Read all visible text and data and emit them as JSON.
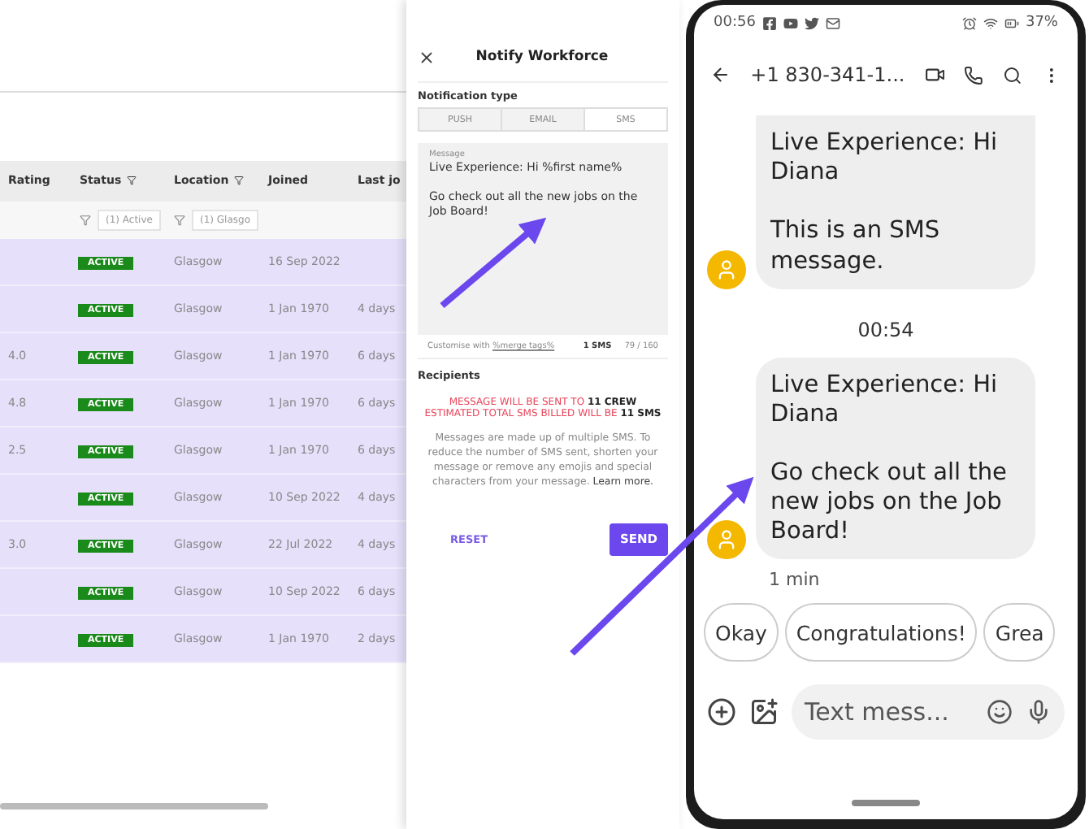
{
  "table": {
    "columns": [
      {
        "label": "Rating"
      },
      {
        "label": "Status",
        "filter": "(1) Active"
      },
      {
        "label": "Location",
        "filter": "(1) Glasgo"
      },
      {
        "label": "Joined"
      },
      {
        "label": "Last jo"
      }
    ],
    "rows": [
      {
        "rating": "",
        "status": "ACTIVE",
        "location": "Glasgow",
        "joined": "16 Sep 2022",
        "last": ""
      },
      {
        "rating": "",
        "status": "ACTIVE",
        "location": "Glasgow",
        "joined": "1 Jan 1970",
        "last": "4 days"
      },
      {
        "rating": "4.0",
        "status": "ACTIVE",
        "location": "Glasgow",
        "joined": "1 Jan 1970",
        "last": "6 days"
      },
      {
        "rating": "4.8",
        "status": "ACTIVE",
        "location": "Glasgow",
        "joined": "1 Jan 1970",
        "last": "6 days"
      },
      {
        "rating": "2.5",
        "status": "ACTIVE",
        "location": "Glasgow",
        "joined": "1 Jan 1970",
        "last": "6 days"
      },
      {
        "rating": "",
        "status": "ACTIVE",
        "location": "Glasgow",
        "joined": "10 Sep 2022",
        "last": "4 days"
      },
      {
        "rating": "3.0",
        "status": "ACTIVE",
        "location": "Glasgow",
        "joined": "22 Jul 2022",
        "last": "4 days"
      },
      {
        "rating": "",
        "status": "ACTIVE",
        "location": "Glasgow",
        "joined": "10 Sep 2022",
        "last": "6 days"
      },
      {
        "rating": "",
        "status": "ACTIVE",
        "location": "Glasgow",
        "joined": "1 Jan 1970",
        "last": "2 days"
      }
    ]
  },
  "panel": {
    "title": "Notify Workforce",
    "type_label": "Notification type",
    "tabs": [
      {
        "label": "PUSH",
        "selected": false
      },
      {
        "label": "EMAIL",
        "selected": false
      },
      {
        "label": "SMS",
        "selected": true
      }
    ],
    "message_label": "Message",
    "message": "Live Experience: Hi %first name%\n\nGo check out all the new jobs on the Job Board!",
    "customise": "Customise with",
    "merge_link": "%merge tags%",
    "sms_count": "1 SMS",
    "char_count": "79 / 160",
    "recipients_label": "Recipients",
    "warnings": [
      "MESSAGE WILL BE SENT TO **11 CREW**",
      "ESTIMATED TOTAL SMS BILLED WILL BE **11 SMS**"
    ],
    "info": "Messages are made up of multiple SMS. To reduce the number of SMS sent, shorten your message or remove any emojis and special characters from your message.",
    "learn_more": "Learn more.",
    "reset": "RESET",
    "send": "SEND"
  },
  "phone": {
    "time": "00:56",
    "battery": "37%",
    "contact": "+1 830-341-1...",
    "messages": [
      {
        "text": "Live Experience: Hi Diana\n\nThis is an SMS message."
      },
      {
        "divider": "00:54"
      },
      {
        "text": "Live Experience: Hi Diana\n\nGo check out all the new jobs on the Job Board!"
      }
    ],
    "age": "1 min",
    "replies": [
      "Okay",
      "Congratulations!",
      "Grea"
    ],
    "placeholder": "Text mess..."
  }
}
